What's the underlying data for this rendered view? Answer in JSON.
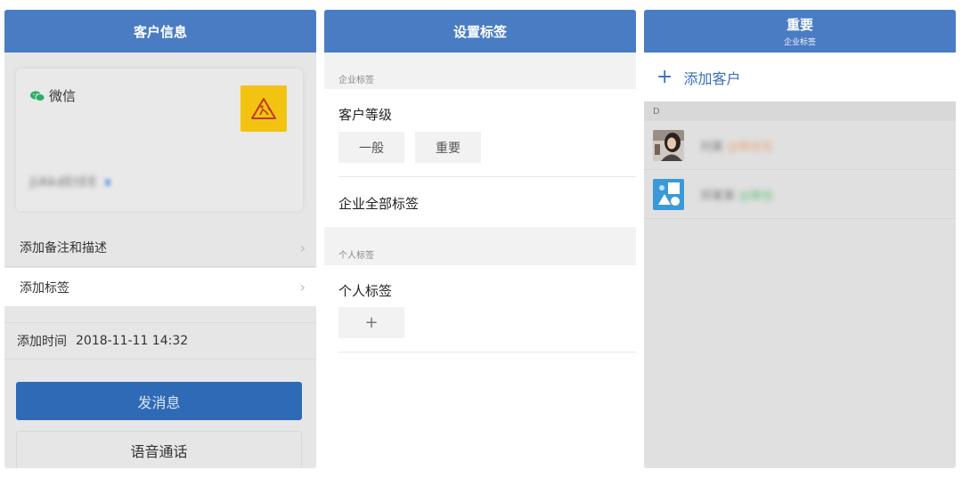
{
  "panel1": {
    "header_title": "客户信息",
    "wechat_label": "微信",
    "nickname_blurred": "JiAkdEtEE",
    "add_remark_label": "添加备注和描述",
    "add_tag_label": "添加标签",
    "add_time_label": "添加时间",
    "add_time_value": "2018-11-11 14:32",
    "send_message_label": "发消息",
    "voice_call_label": "语音通话",
    "chevron": "›"
  },
  "panel2": {
    "header_title": "设置标签",
    "corp_section_label": "企业标签",
    "customer_level_title": "客户等级",
    "chip_normal": "一般",
    "chip_important": "重要",
    "corp_all_tags_label": "企业全部标签",
    "personal_section_label": "个人标签",
    "personal_tags_title": "个人标签",
    "add_chip": "+"
  },
  "panel3": {
    "header_title": "重要",
    "header_subtitle": "企业标签",
    "add_customer_plus": "+",
    "add_customer_label": "添加客户",
    "index_letter": "D",
    "customers": [
      {
        "name_blurred": "刘某",
        "suffix_blurred": "@微信名"
      },
      {
        "name_blurred": "邓某某",
        "suffix_blurred": "@微信"
      }
    ]
  },
  "colors": {
    "header_blue": "#4a7cc4",
    "primary_button": "#2f6ab7",
    "wechat_green": "#2aae67",
    "warning_yellow": "#f2c311",
    "link_blue": "#3a6fb8"
  }
}
